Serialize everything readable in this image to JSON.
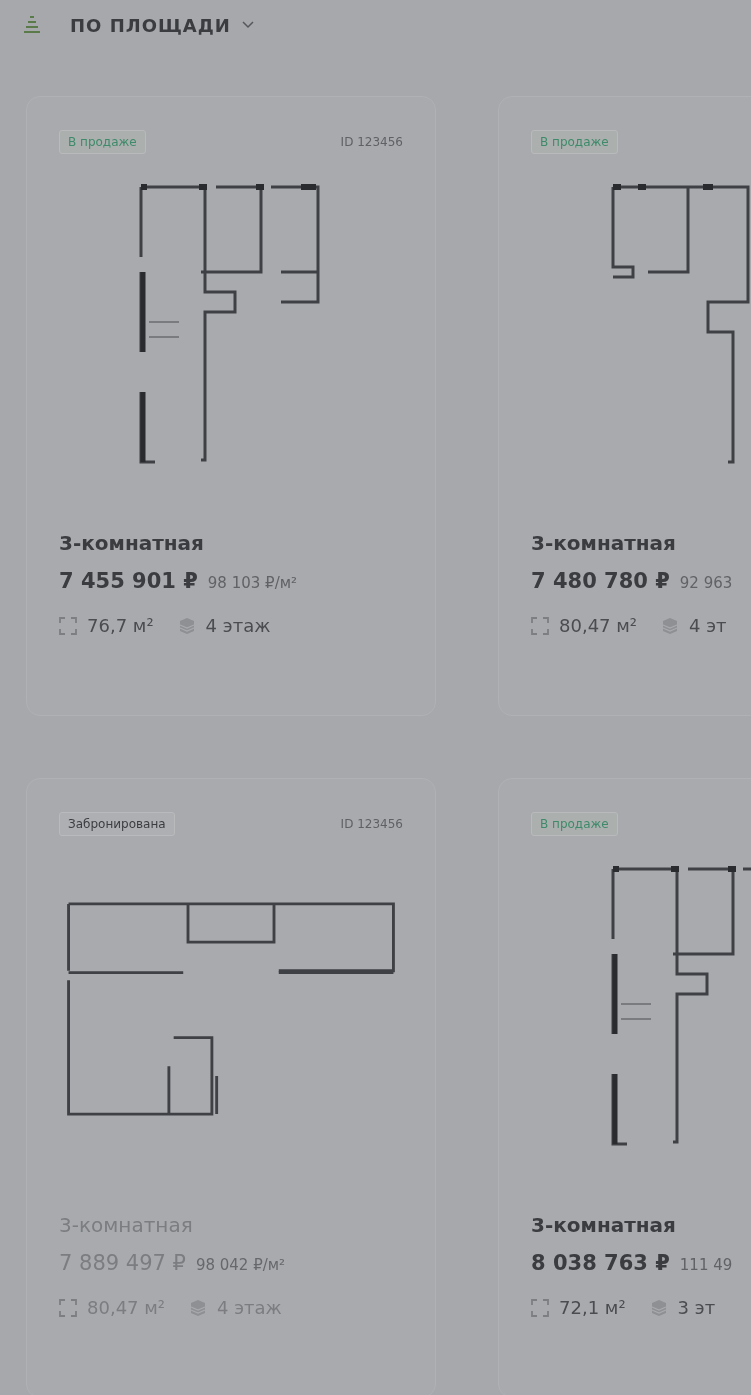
{
  "sort": {
    "label": "ПО ПЛОЩАДИ"
  },
  "cards": [
    {
      "status": {
        "kind": "on_sale",
        "label": "В продаже"
      },
      "id": "ID 123456",
      "disabled": false,
      "kind": "plan_a",
      "title": "3-комнатная",
      "price": "7 455 901 ₽",
      "price_per_m2": "98 103 ₽/м²",
      "area": "76,7 м²",
      "floor": "4 этаж"
    },
    {
      "status": {
        "kind": "on_sale",
        "label": "В продаже"
      },
      "disabled": false,
      "kind": "plan_b",
      "title": "3-комнатная",
      "price": "7 480 780 ₽",
      "price_per_m2": "92 963",
      "area": "80,47 м²",
      "floor": "4 эт"
    },
    {
      "status": {
        "kind": "booked",
        "label": "Забронирована"
      },
      "id": "ID 123456",
      "disabled": true,
      "kind": "plan_c",
      "title": "3-комнатная",
      "price": "7 889 497 ₽",
      "price_per_m2": "98 042 ₽/м²",
      "area": "80,47 м²",
      "floor": "4 этаж"
    },
    {
      "status": {
        "kind": "on_sale",
        "label": "В продаже"
      },
      "disabled": false,
      "kind": "plan_a",
      "title": "3-комнатная",
      "price": "8 038 763 ₽",
      "price_per_m2": "111 49",
      "area": "72,1 м²",
      "floor": "3 эт"
    }
  ]
}
